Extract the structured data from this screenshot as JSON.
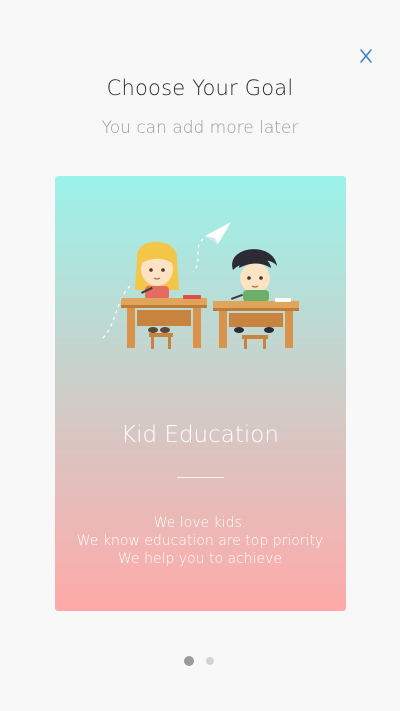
{
  "header": {
    "title": "Choose Your Goal",
    "subtitle": "You can add more later",
    "close_icon": "close-icon",
    "accent_color": "#3d83c6"
  },
  "card": {
    "title": "Kid Education",
    "description_lines": [
      "We love kids.",
      "We know education are top priority",
      "We help you to achieve"
    ],
    "gradient_top": "#9af3ea",
    "gradient_bottom": "#ffaaa9",
    "illustration": "kids-at-desks-illustration"
  },
  "pagination": {
    "total_pages": 2,
    "active_page": 1
  }
}
